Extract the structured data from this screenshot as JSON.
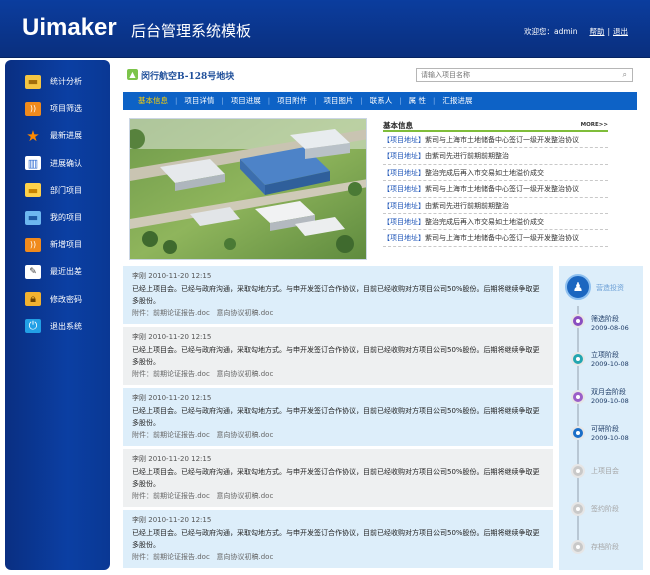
{
  "header": {
    "logo": "Uimaker",
    "subtitle": "后台管理系统模板",
    "welcome": "欢迎您：admin",
    "sep": "|",
    "help": "帮助",
    "logout": "退出"
  },
  "sidebar": {
    "items": [
      {
        "label": "统计分析",
        "icon": "folder-icon"
      },
      {
        "label": "项目筛选",
        "icon": "rss-icon"
      },
      {
        "label": "最新进展",
        "icon": "star-icon"
      },
      {
        "label": "进展确认",
        "icon": "chart-icon"
      },
      {
        "label": "部门项目",
        "icon": "folder-icon"
      },
      {
        "label": "我的项目",
        "icon": "folder-icon"
      },
      {
        "label": "新增项目",
        "icon": "rss-icon"
      },
      {
        "label": "最近出差",
        "icon": "document-icon"
      },
      {
        "label": "修改密码",
        "icon": "lock-icon"
      },
      {
        "label": "退出系统",
        "icon": "power-icon"
      }
    ]
  },
  "main": {
    "title": "闵行航空B-128号地块",
    "search_placeholder": "请输入项目名称",
    "tabs": [
      "基本信息",
      "项目详情",
      "项目进展",
      "项目附件",
      "项目图片",
      "联系人",
      "属 性",
      "汇报进展"
    ],
    "tab_sep": "|"
  },
  "info": {
    "title": "基本信息",
    "more": "MORE>>",
    "rows": [
      {
        "tag": "【项目地址】",
        "text": "紫司与上海市土地储备中心签订一级开发整治协议"
      },
      {
        "tag": "【项目地址】",
        "text": "由紫司先进行前期前期整治"
      },
      {
        "tag": "【项目地址】",
        "text": "整治完成后再入市交易如土地溢价成交"
      },
      {
        "tag": "【项目地址】",
        "text": "紫司与上海市土地储备中心签订一级开发整治协议"
      },
      {
        "tag": "【项目地址】",
        "text": "由紫司先进行前期前期整治"
      },
      {
        "tag": "【项目地址】",
        "text": "整治完成后再入市交易如土地溢价成交"
      },
      {
        "tag": "【项目地址】",
        "text": "紫司与上海市土地储备中心签订一级开发整治协议"
      }
    ]
  },
  "records": [
    {
      "author": "李刚",
      "time": "2010-11-20 12:15",
      "body": "已经上项目会。已经与政府沟通，采取勾地方式。与申开发签订合作协议，目前已经收购对方项目公司50%股份。后期将继续争取更多股份。",
      "attach_label": "附件：",
      "attach1": "前期论证报告.doc",
      "attach2": "意向协议初稿.doc"
    },
    {
      "author": "李刚",
      "time": "2010-11-20 12:15",
      "body": "已经上项目会。已经与政府沟通，采取勾地方式。与申开发签订合作协议，目前已经收购对方项目公司50%股份。后期将继续争取更多股份。",
      "attach_label": "附件：",
      "attach1": "前期论证报告.doc",
      "attach2": "意向协议初稿.doc"
    },
    {
      "author": "李刚",
      "time": "2010-11-20 12:15",
      "body": "已经上项目会。已经与政府沟通，采取勾地方式。与申开发签订合作协议，目前已经收购对方项目公司50%股份。后期将继续争取更多股份。",
      "attach_label": "附件：",
      "attach1": "前期论证报告.doc",
      "attach2": "意向协议初稿.doc"
    },
    {
      "author": "李刚",
      "time": "2010-11-20 12:15",
      "body": "已经上项目会。已经与政府沟通，采取勾地方式。与申开发签订合作协议，目前已经收购对方项目公司50%股份。后期将继续争取更多股份。",
      "attach_label": "附件：",
      "attach1": "前期论证报告.doc",
      "attach2": "意向协议初稿.doc"
    },
    {
      "author": "李刚",
      "time": "2010-11-20 12:15",
      "body": "已经上项目会。已经与政府沟通，采取勾地方式。与申开发签订合作协议，目前已经收购对方项目公司50%股份。后期将继续争取更多股份。",
      "attach_label": "附件：",
      "attach1": "前期论证报告.doc",
      "attach2": "意向协议初稿.doc"
    }
  ],
  "timeline": {
    "start": "营造投资",
    "nodes": [
      {
        "label": "筛选阶段",
        "date": "2009-08-06",
        "color": "#8a4ec0",
        "done": true
      },
      {
        "label": "立项阶段",
        "date": "2009-10-08",
        "color": "#23a6b0",
        "done": true
      },
      {
        "label": "双月会阶段",
        "date": "2009-10-08",
        "color": "#9b5fc8",
        "done": true
      },
      {
        "label": "可研阶段",
        "date": "2009-10-08",
        "color": "#1a6ec8",
        "done": true
      },
      {
        "label": "上项目会",
        "date": "",
        "color": "#c9c9c9",
        "done": false
      },
      {
        "label": "签约阶段",
        "date": "",
        "color": "#c9c9c9",
        "done": false
      },
      {
        "label": "存档阶段",
        "date": "",
        "color": "#c9c9c9",
        "done": false
      }
    ]
  },
  "colors": {
    "header_bg": "#0b3d9e",
    "tab_bar": "#0d62c6",
    "tab_active": "#ffd200",
    "accent_green": "#7fbd3a"
  }
}
